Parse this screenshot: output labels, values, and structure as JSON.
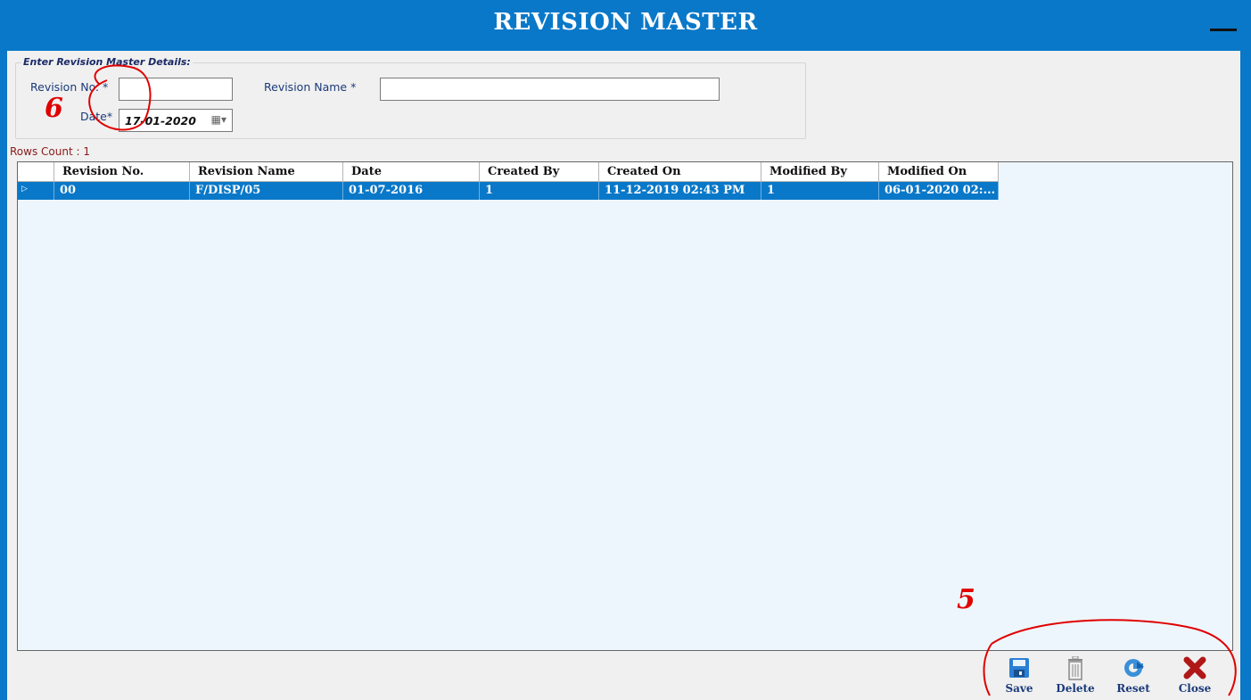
{
  "window": {
    "title": "REVISION MASTER",
    "accent_color": "#0a78c8"
  },
  "form": {
    "group_title": "Enter Revision Master Details:",
    "revision_no_label": "Revision No. *",
    "revision_no_value": "",
    "revision_name_label": "Revision Name *",
    "revision_name_value": "",
    "date_label": "Date*",
    "date_value": "17-01-2020",
    "date_icon": "calendar-dropdown-icon"
  },
  "rows_count": "Rows Count : 1",
  "grid": {
    "columns": [
      "Revision No.",
      "Revision Name",
      "Date",
      "Created By",
      "Created On",
      "Modified By",
      "Modified On"
    ],
    "rows": [
      {
        "indicator": "▷",
        "cells": [
          "00",
          "F/DISP/05",
          "01-07-2016",
          "1",
          "11-12-2019 02:43 PM",
          "1",
          "06-01-2020 02:..."
        ]
      }
    ]
  },
  "toolbar": {
    "save_label": "Save",
    "delete_label": "Delete",
    "reset_label": "Reset",
    "close_label": "Close",
    "icons": [
      "save-icon",
      "delete-icon",
      "reset-icon",
      "close-icon"
    ]
  },
  "annotations": {
    "marker_six": "6",
    "marker_five": "5",
    "color": "#e00000"
  }
}
